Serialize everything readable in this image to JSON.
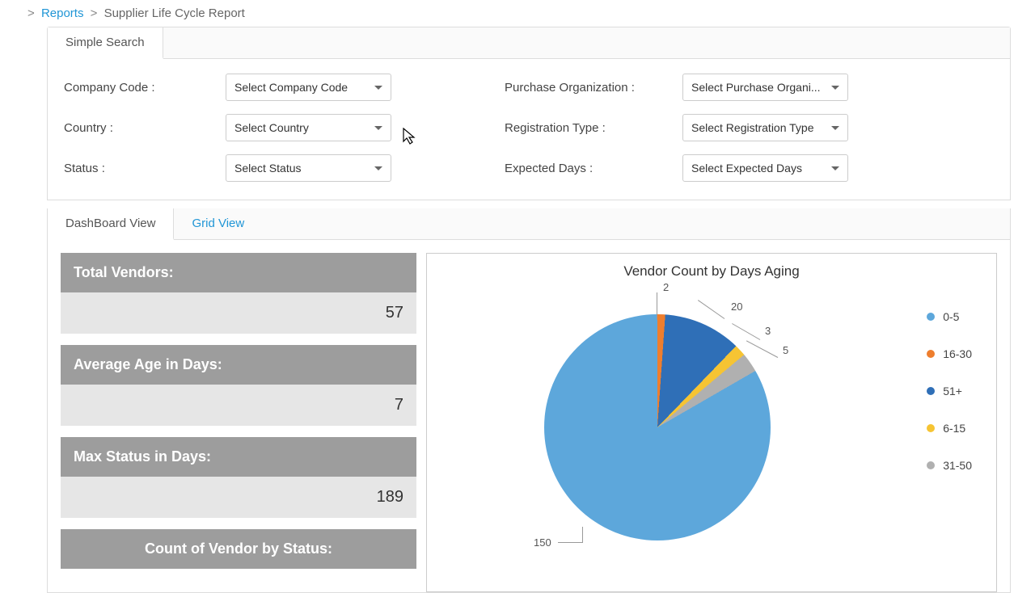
{
  "breadcrumb": {
    "reports_link": "Reports",
    "current": "Supplier Life Cycle Report"
  },
  "search_tab": "Simple Search",
  "filters": {
    "left": [
      {
        "label": "Company Code :",
        "value": "Select Company Code"
      },
      {
        "label": "Country :",
        "value": "Select Country"
      },
      {
        "label": "Status :",
        "value": "Select Status"
      }
    ],
    "right": [
      {
        "label": "Purchase Organization :",
        "value": "Select Purchase Organi..."
      },
      {
        "label": "Registration Type :",
        "value": "Select Registration Type"
      },
      {
        "label": "Expected Days :",
        "value": "Select Expected Days"
      }
    ]
  },
  "view_tabs": {
    "dashboard": "DashBoard View",
    "grid": "Grid View"
  },
  "cards": {
    "total_vendors_label": "Total Vendors:",
    "total_vendors_value": "57",
    "avg_age_label": "Average Age in Days:",
    "avg_age_value": "7",
    "max_status_label": "Max Status in Days:",
    "max_status_value": "189",
    "count_by_status_label": "Count of Vendor by Status:"
  },
  "chart_data": {
    "type": "pie",
    "title": "Vendor Count by Days Aging",
    "series": [
      {
        "name": "0-5",
        "value": 150,
        "color": "#5da7db"
      },
      {
        "name": "16-30",
        "value": 2,
        "color": "#ee7e2e"
      },
      {
        "name": "51+",
        "value": 20,
        "color": "#2f6fb7"
      },
      {
        "name": "6-15",
        "value": 3,
        "color": "#f6c433"
      },
      {
        "name": "31-50",
        "value": 5,
        "color": "#b0b0b0"
      }
    ],
    "legend_order": [
      "0-5",
      "16-30",
      "51+",
      "6-15",
      "31-50"
    ],
    "callouts": {
      "v150": "150",
      "v2": "2",
      "v20": "20",
      "v3": "3",
      "v5": "5"
    }
  }
}
